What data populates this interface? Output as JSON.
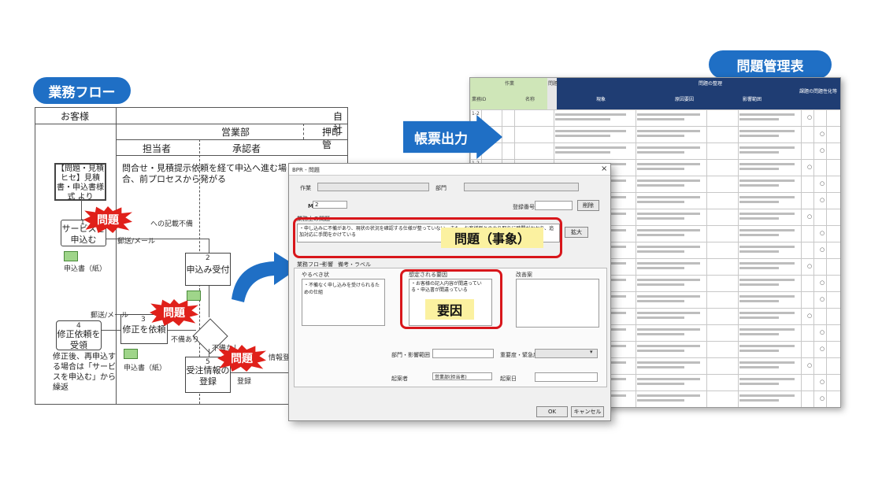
{
  "labels": {
    "flow_pill": "業務フロー",
    "table_pill": "問題管理表",
    "arrow": "帳票出力"
  },
  "flow": {
    "col_customer": "お客様",
    "col_company": "自社",
    "col_sales": "営業部",
    "col_print": "押印管",
    "col_staff": "担当者",
    "col_approver": "承認者",
    "box_quote": "【問題・見積ヒセ】見積書・申込書様式 より",
    "box_service": "サービスを申込む",
    "box_accept": "申込み受付",
    "box_fix_request": "修正を依頼",
    "box_fix_accept": "修正依頼を受領",
    "box_register": "受注情報の登録",
    "note_inquiry": "問合せ・見積提示依頼を経て申込へ進む場合、前プロセスから発がる",
    "note_retry": "修正後、再申込する場合は「サービスを申込む」から繰返",
    "doc_application": "申込書（紙）",
    "doc_application2": "申込書（紙）",
    "small_mail": "郵送/メール",
    "small_mail2": "郵送/メール",
    "small_defect": "不備あり",
    "small_nodefect": "不備なし",
    "small_entry": "への記載不備",
    "small_register": "登録",
    "small_info": "情報登録",
    "num1": "1",
    "num2": "2",
    "num3": "3",
    "num4": "4",
    "num5": "5",
    "burst": [
      "問題",
      "問題",
      "問題"
    ]
  },
  "dialog": {
    "title": "BPR - 問題",
    "lbl_work": "作業",
    "lbl_dept": "部門",
    "lbl_m": "M",
    "val_m": "2",
    "lbl_regno": "登録番号",
    "btn_delete": "削除",
    "lbl_problem": "業務上の問題",
    "problem_text": "・申し込みに不備があり、現状の状況を確認する仕様が整っていない。また、お客様側とのやり取りに時間がかかり、追加対応に手間をかけている",
    "btn_expand": "拡大",
    "tab_1": "業務フロー",
    "tab_2": "影響",
    "tab_3": "備考・ラベル",
    "lbl_todo": "やるべき状",
    "todo_text": "・不備なく申し込みを受けられるための仕組",
    "lbl_cause": "想定される要因",
    "cause_text": "・お客様の記入内容が間違っている・申込書が間違っている",
    "lbl_improve": "改善案",
    "lbl_owner_dept": "部門・影響範囲",
    "lbl_priority": "重要度・緊急度",
    "lbl_author": "起案者",
    "val_author": "営業部(担当者)",
    "lbl_date": "起案日",
    "btn_ok": "OK",
    "btn_cancel": "キャンセル",
    "callout_problem": "問題（事象）",
    "callout_cause": "要因"
  },
  "sheet": {
    "top_left": "作業",
    "top_mid": "問題",
    "top_right": "問題の整理",
    "top_far": "課題の問題性化等",
    "col_id": "業務ID",
    "col_name": "名称",
    "col_phenomenon": "現象",
    "col_cause": "原因要因",
    "col_dept": "影響範囲",
    "row_ids": [
      "1-2",
      "1-2",
      "1-2",
      "1-2",
      "1-2",
      "1-2",
      "1-2",
      "1-2",
      "1-2",
      "1-2",
      "1-2",
      "1-2",
      "1-2",
      "1-2",
      "1-2",
      "1-2",
      "1-2",
      "1-2"
    ],
    "mark": "○"
  },
  "colors": {
    "accent": "#1f6fc5",
    "burst": "#e0201a",
    "callout_border": "#d8161b",
    "callout_fill": "#fbf1a0",
    "sheet_header": "#1f3d73"
  }
}
